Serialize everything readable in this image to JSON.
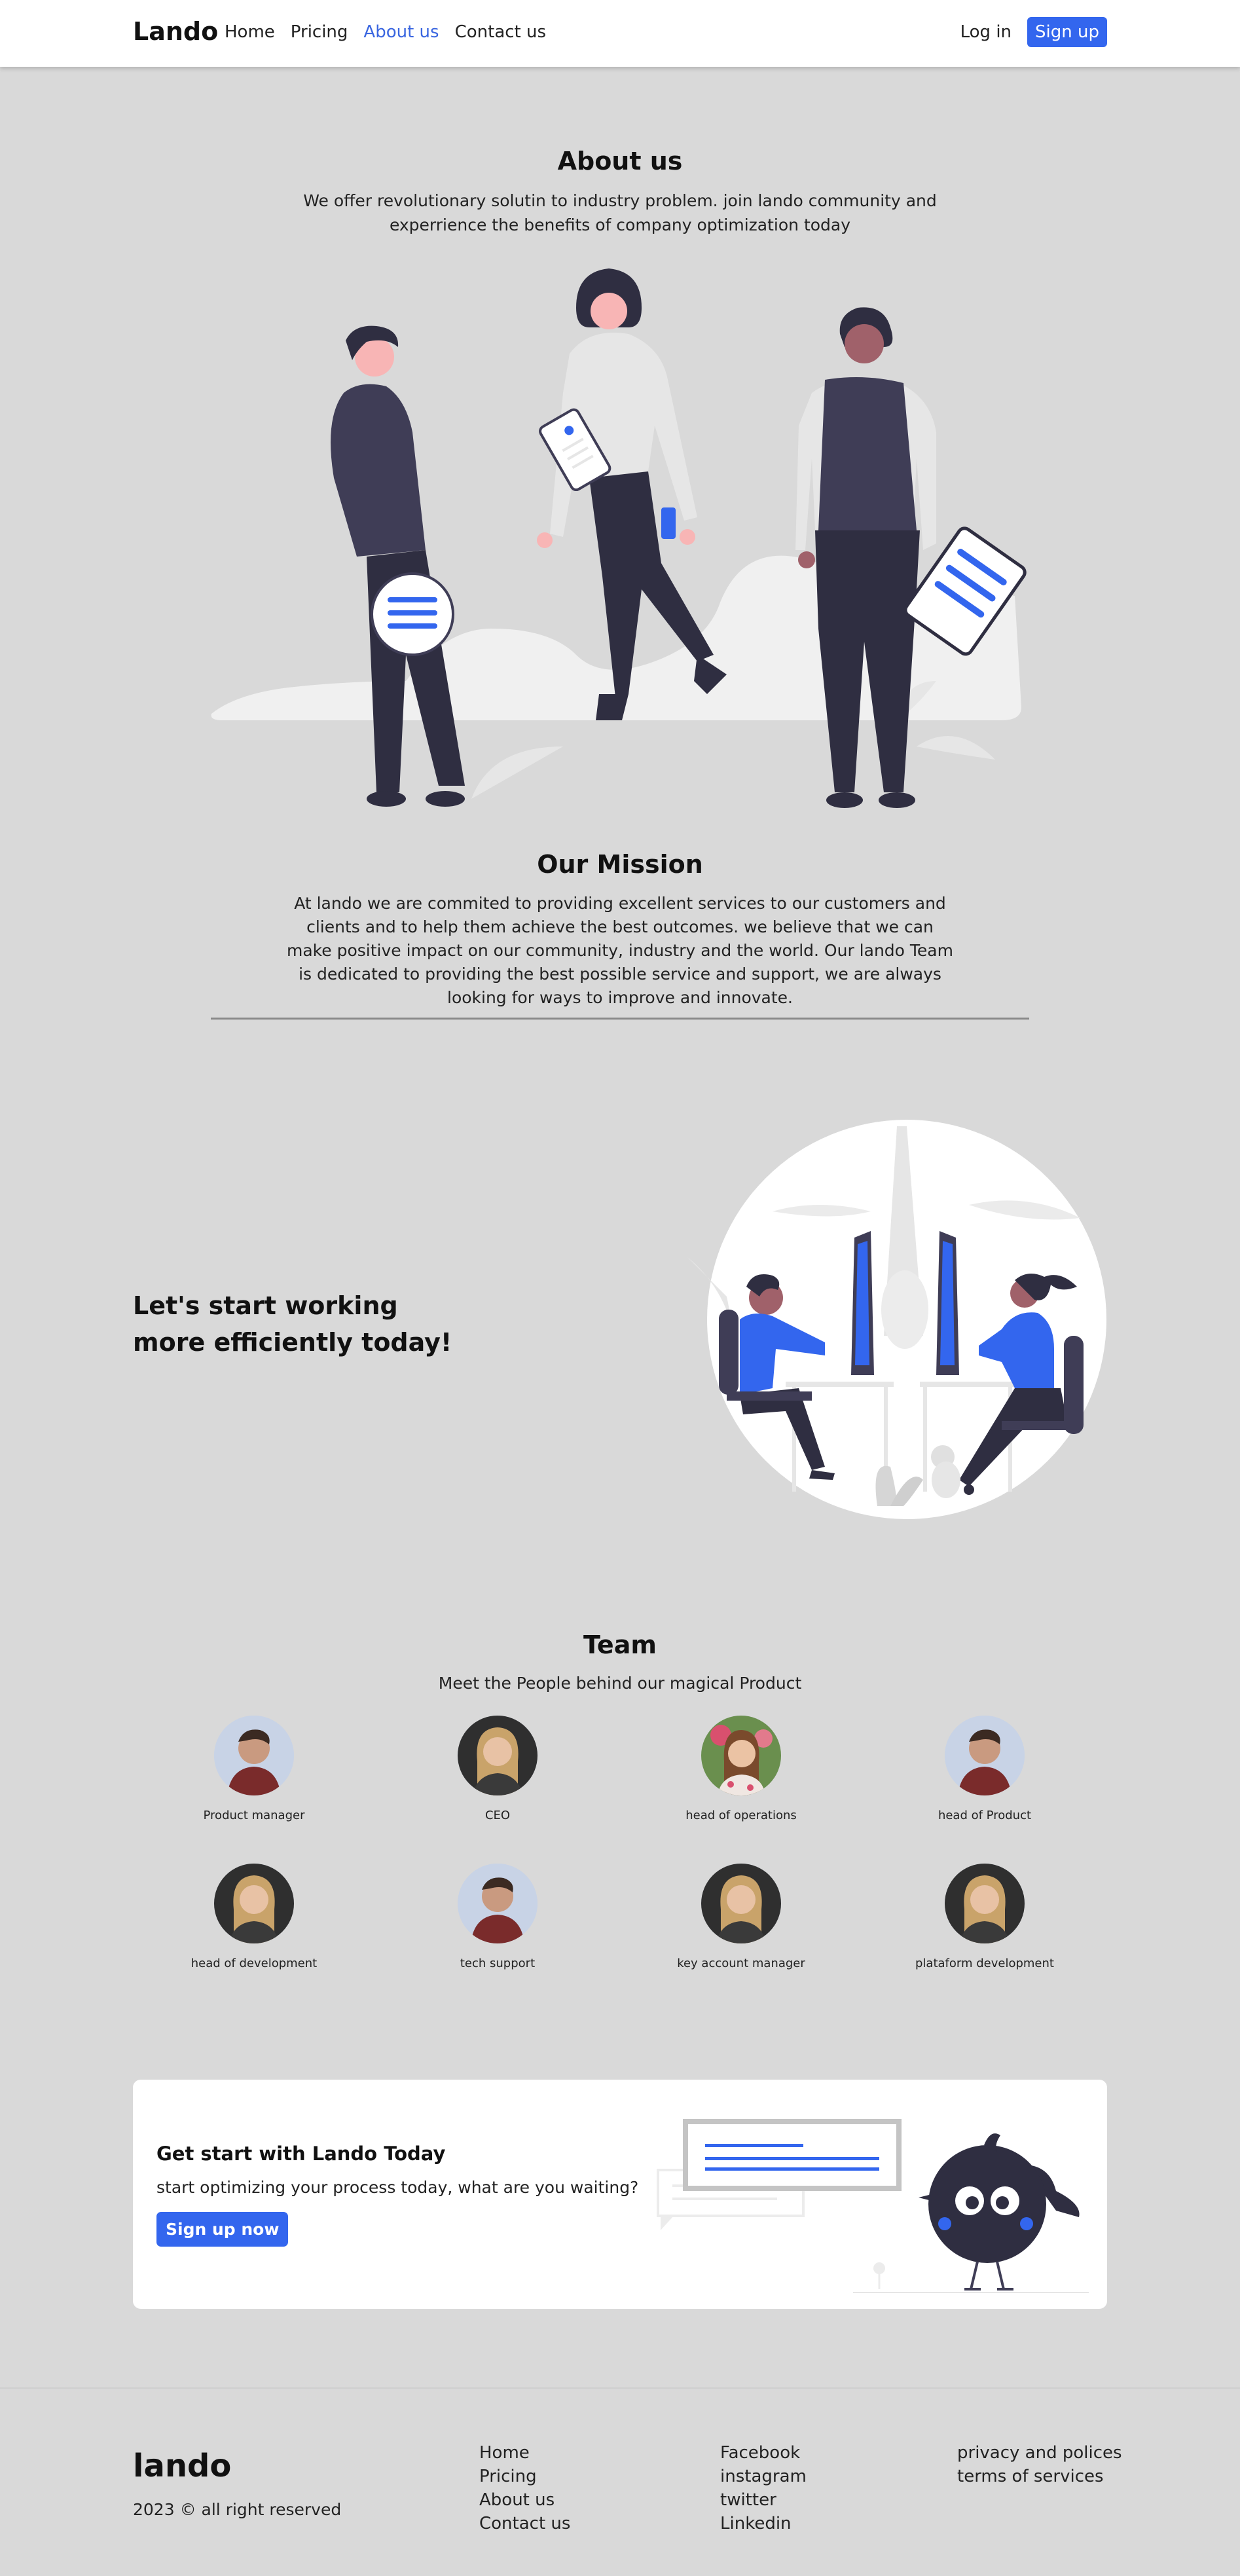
{
  "navbar": {
    "brand": "Lando",
    "links": [
      "Home",
      "Pricing",
      "About us",
      "Contact us"
    ],
    "active_link": "About us",
    "login": "Log in",
    "signup": "Sign up",
    "accent": "#3366ee"
  },
  "about": {
    "title": "About us",
    "subtitle": "We offer revolutionary solutin to industry problem. join lando community and experrience the benefits of company optimization today"
  },
  "mission": {
    "title": "Our Mission",
    "text": "At lando we are commited to providing excellent services to our customers and clients and to help them achieve the best outcomes. we believe that we can make positive impact on our community, industry and the world. Our lando Team is dedicated to providing the best possible service and support, we are always looking for ways to improve and innovate."
  },
  "work": {
    "title": "Let's start working more efficiently today!"
  },
  "team": {
    "title": "Team",
    "subtitle": "Meet the People behind our magical Product",
    "members": [
      {
        "role": "Product manager",
        "avatar": "man-photo"
      },
      {
        "role": "CEO",
        "avatar": "woman-blonde-photo"
      },
      {
        "role": "head of operations",
        "avatar": "woman-flowers-photo"
      },
      {
        "role": "head of Product",
        "avatar": "man-photo"
      },
      {
        "role": "head of development",
        "avatar": "woman-blonde-photo"
      },
      {
        "role": "tech support",
        "avatar": "man-photo"
      },
      {
        "role": "key account manager",
        "avatar": "woman-blonde-photo"
      },
      {
        "role": "plataform development",
        "avatar": "woman-blonde-photo"
      }
    ]
  },
  "cta": {
    "title": "Get start with Lando Today",
    "subtitle": "start optimizing your process today, what are you waiting?",
    "button": "Sign up now"
  },
  "footer": {
    "brand": "lando",
    "copyright": "2023 © all right reserved",
    "col1": [
      "Home",
      "Pricing",
      "About us",
      "Contact us"
    ],
    "col2": [
      "Facebook",
      "instagram",
      "twitter",
      "Linkedin"
    ],
    "col3": [
      "privacy and polices",
      "terms of services"
    ]
  }
}
